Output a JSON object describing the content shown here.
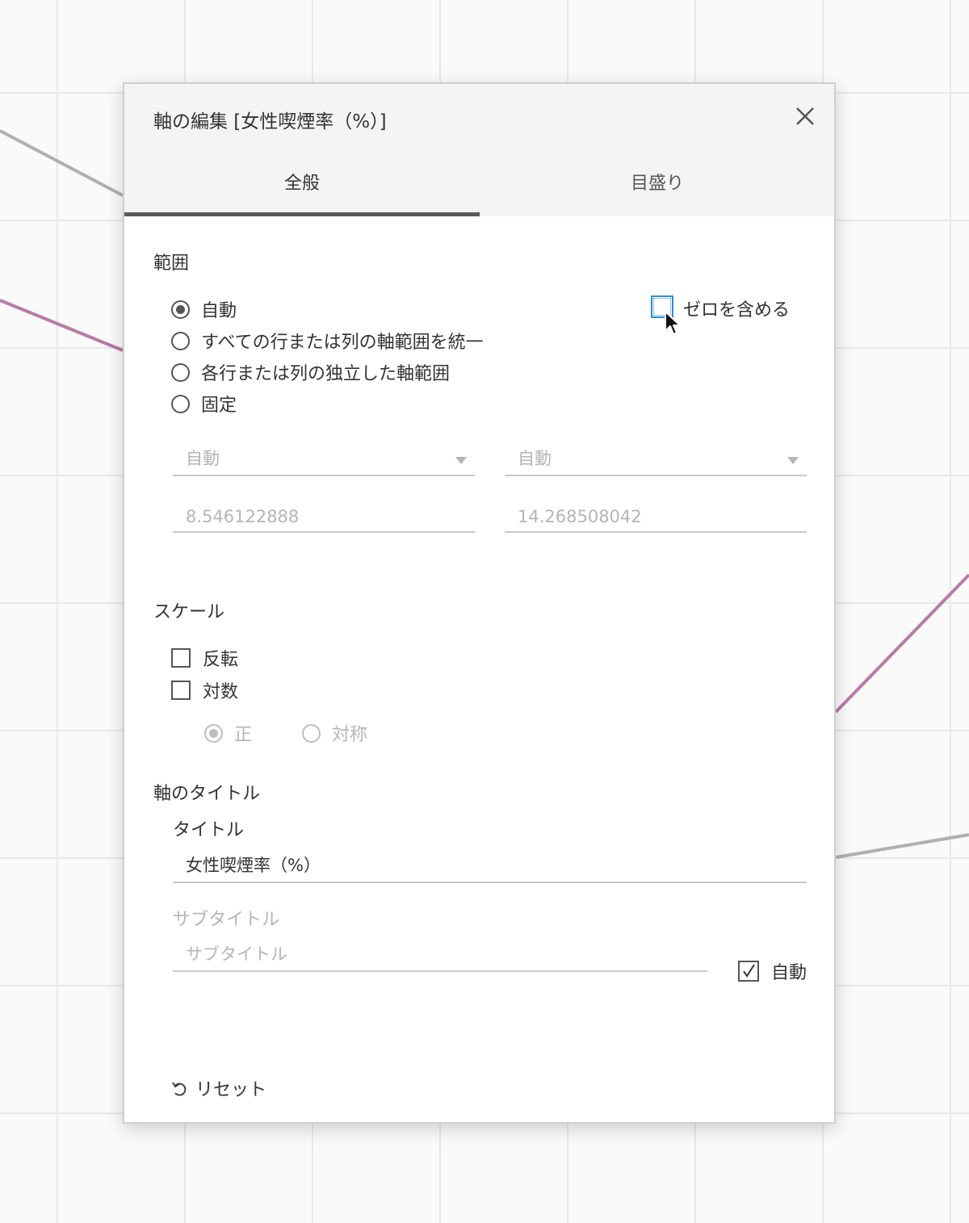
{
  "dialog": {
    "title": "軸の編集 [女性喫煙率（%）]",
    "close_icon": "close-icon"
  },
  "tabs": [
    {
      "label": "全般",
      "active": true
    },
    {
      "label": "目盛り",
      "active": false
    }
  ],
  "range": {
    "heading": "範囲",
    "options": [
      {
        "label": "自動",
        "checked": true
      },
      {
        "label": "すべての行または列の軸範囲を統一",
        "checked": false
      },
      {
        "label": "各行または列の独立した軸範囲",
        "checked": false
      },
      {
        "label": "固定",
        "checked": false
      }
    ],
    "include_zero": {
      "label": "ゼロを含める",
      "checked": false
    },
    "start_select": "自動",
    "end_select": "自動",
    "start_value": "8.546122888",
    "end_value": "14.268508042"
  },
  "scale": {
    "heading": "スケール",
    "reverse": {
      "label": "反転",
      "checked": false
    },
    "log": {
      "label": "対数",
      "checked": false
    },
    "log_options": [
      {
        "label": "正",
        "checked": true
      },
      {
        "label": "対称",
        "checked": false
      }
    ]
  },
  "axis_title": {
    "heading": "軸のタイトル",
    "title_label": "タイトル",
    "title_value": "女性喫煙率（%）",
    "subtitle_label": "サブタイトル",
    "subtitle_placeholder": "サブタイトル",
    "auto": {
      "label": "自動",
      "checked": true
    }
  },
  "footer": {
    "reset_label": "リセット"
  },
  "colors": {
    "accent": "#2b8fd6",
    "gray_line": "#b4aeae",
    "purple_line": "#b97aa8"
  }
}
